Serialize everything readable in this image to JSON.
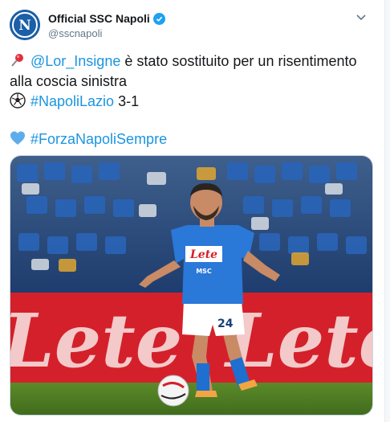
{
  "tweet": {
    "author_name": "Official SSC Napoli",
    "author_handle": "@sscnapoli",
    "mention": "@Lor_Insigne",
    "line1_rest": " è stato sostituito per un risentimento",
    "line2": "alla coscia sinistra",
    "hashtag_match": "#NapoliLazio",
    "score": " 3-1",
    "hashtag_forza": "#ForzaNapoliSempre"
  },
  "media": {
    "banner_text": "Lete",
    "jersey_sponsor": "Lete",
    "jersey_sub_sponsor": "MSC",
    "shorts_number": "24"
  },
  "icons": {
    "pushpin": "pushpin-icon",
    "soccer_ball": "soccer-ball-icon",
    "blue_heart": "blue-heart-icon",
    "verified": "verified-badge-icon",
    "chevron": "chevron-down-icon"
  },
  "colors": {
    "link": "#1b95e0",
    "verified": "#1da1f2",
    "napoli_blue": "#1a5fa8",
    "banner_red": "#d4202a"
  }
}
